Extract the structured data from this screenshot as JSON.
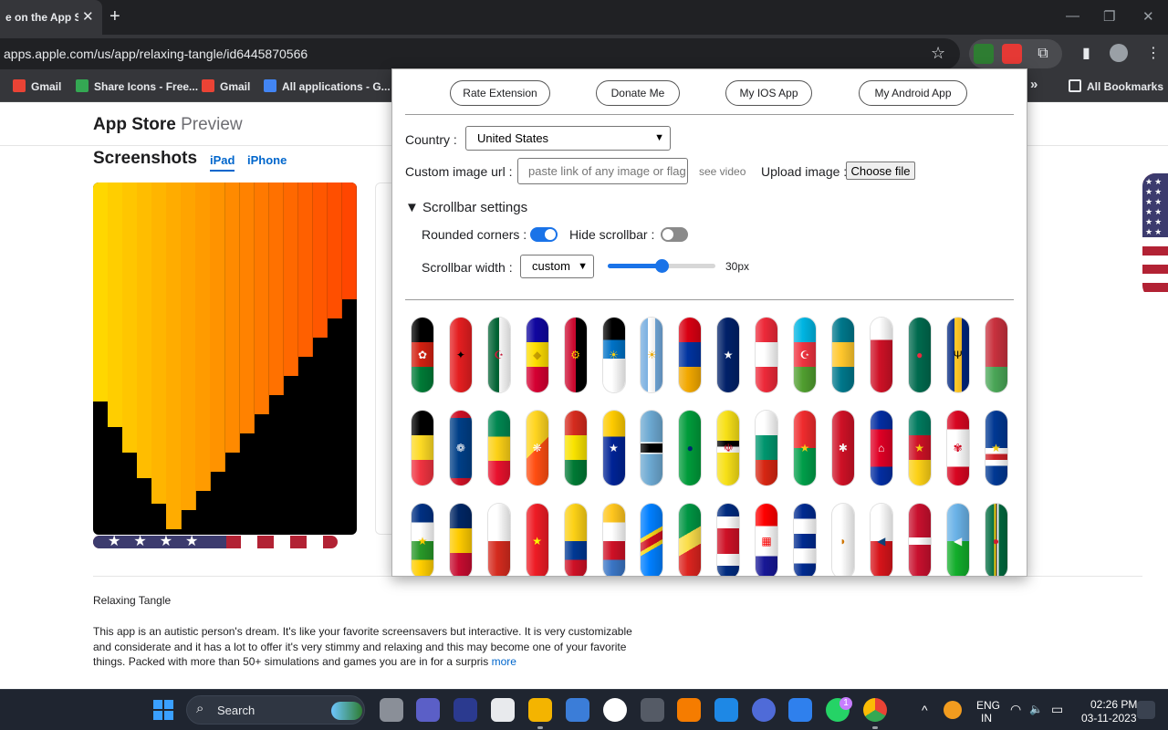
{
  "browser": {
    "tab_title": "e on the App Sto",
    "close_glyph": "✕",
    "new_tab_glyph": "+",
    "window_controls": [
      "—",
      "❐",
      "✕"
    ],
    "url": "apps.apple.com/us/app/relaxing-tangle/id6445870566",
    "star_glyph": "☆",
    "toolbar_glyphs": {
      "puzzle": "⧉",
      "sidebar": "▮",
      "menu": "⋮"
    },
    "bookmarks": [
      {
        "label": "Gmail",
        "icon": "gmail-icon",
        "color": "#ea4335"
      },
      {
        "label": "Share Icons - Free...",
        "icon": "share-icons-icon",
        "color": "#34a853"
      },
      {
        "label": "Gmail",
        "icon": "gmail-icon",
        "color": "#ea4335"
      },
      {
        "label": "All applications - G...",
        "icon": "applications-icon",
        "color": "#4285f4"
      }
    ],
    "bookmarks_overflow": "»",
    "all_bookmarks": "All Bookmarks"
  },
  "page": {
    "store_title": "App Store",
    "store_subtitle": "Preview",
    "screenshots_heading": "Screenshots",
    "device_tabs": [
      "iPad",
      "iPhone"
    ],
    "app_name": "Relaxing Tangle",
    "description": "This app is an autistic person's dream. It's like your favorite screensavers but interactive. It is very customizable and considerate and it has a lot to offer it's very stimmy and relaxing and this may become one of your favorite things. Packed with more than 50+ simulations and games you are in for a surpris",
    "more_link": "more",
    "scroll_stars": "★★★★"
  },
  "popup": {
    "buttons": [
      "Rate Extension",
      "Donate Me",
      "My IOS App",
      "My Android App"
    ],
    "country_label": "Country :",
    "country_value": "United States",
    "custom_image_label": "Custom image url :",
    "custom_image_placeholder": "paste link of any image or flag",
    "see_video": "see video",
    "upload_label": "Upload image :",
    "choose_file": "Choose file",
    "scrollbar_settings": "▼ Scrollbar settings",
    "rounded_label": "Rounded corners :",
    "rounded_on": true,
    "hide_label": "Hide scrollbar :",
    "hide_on": false,
    "width_label": "Scrollbar width :",
    "width_value": "custom",
    "slider_fraction": 0.5,
    "slider_value": "30px",
    "accent_color": "#1a73e8",
    "flags": [
      [
        "Afghanistan",
        "Albania",
        "Algeria",
        "Andorra",
        "Angola",
        "Antigua and Barbuda",
        "Argentina",
        "Armenia",
        "Australia",
        "Austria",
        "Azerbaijan",
        "Bahamas",
        "Bahrain",
        "Bangladesh",
        "Barbados",
        "Belarus"
      ],
      [
        "Belgium",
        "Belize",
        "Benin",
        "Bhutan",
        "Bolivia",
        "Bosnia and Herzegovina",
        "Botswana",
        "Brazil",
        "Brunei",
        "Bulgaria",
        "Burkina Faso",
        "Burundi",
        "Cambodia",
        "Cameroon",
        "Canada",
        "Cape Verde"
      ],
      [
        "Central African Republic",
        "Chad",
        "Chile",
        "China",
        "Colombia",
        "Comoros",
        "DR Congo",
        "Congo",
        "Costa Rica",
        "Croatia",
        "Cuba",
        "Cyprus",
        "Czech Republic",
        "Denmark",
        "Djibouti",
        "Dominica"
      ]
    ]
  },
  "taskbar": {
    "search_label": "Search",
    "search_glyph": "⌕",
    "whatsapp_badge": "1",
    "lang_line1": "ENG",
    "lang_line2": "IN",
    "time": "02:26 PM",
    "date": "03-11-2023",
    "tray_glyphs": {
      "chevron": "^",
      "wifi": "◠",
      "volume": "🔈",
      "battery": "▭"
    }
  }
}
